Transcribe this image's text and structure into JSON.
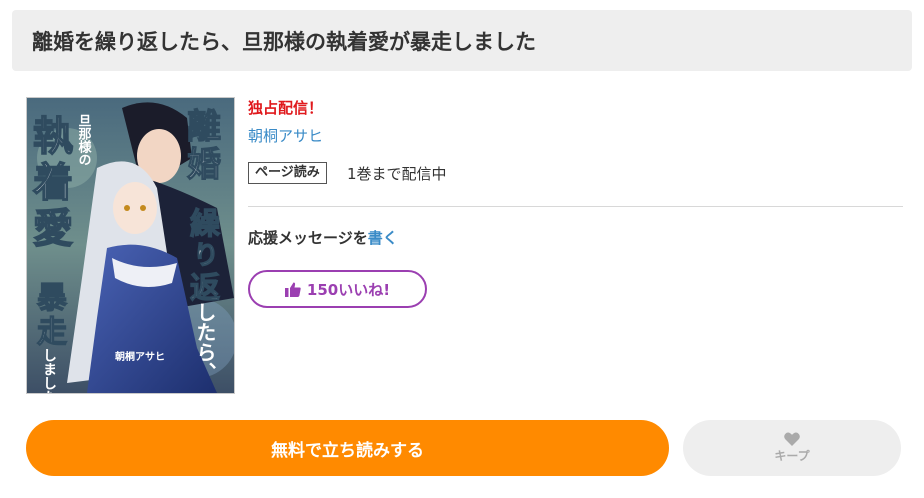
{
  "title": "離婚を繰り返したら、旦那様の執着愛が暴走しました",
  "cover": {
    "alt": "離婚を繰り返したら、旦那様の執着愛が暴走しました 表紙",
    "title_big_1": "執",
    "title_big_2": "着",
    "title_big_3": "愛",
    "title_small": "旦那様の",
    "title_right_1": "離",
    "title_right_2": "婚",
    "title_right_3": "繰",
    "title_right_4": "り",
    "title_right_5": "返",
    "title_right_6": "したら、",
    "title_left_1": "暴",
    "title_left_2": "走",
    "title_left_3": "しました",
    "cover_author": "朝桐アサヒ"
  },
  "info": {
    "exclusive": "独占配信！",
    "author": "朝桐アサヒ",
    "badge": "ページ読み",
    "availability": "1巻まで配信中",
    "support_prefix": "応援メッセージを",
    "support_link": "書く",
    "like_label": "150いいね!"
  },
  "actions": {
    "read_label": "無料で立ち読みする",
    "keep_label": "キープ"
  },
  "colors": {
    "accent_orange": "#ff8a00",
    "exclusive_red": "#e0191d",
    "link_blue": "#3a8bc7",
    "like_purple": "#9b3fb1"
  }
}
